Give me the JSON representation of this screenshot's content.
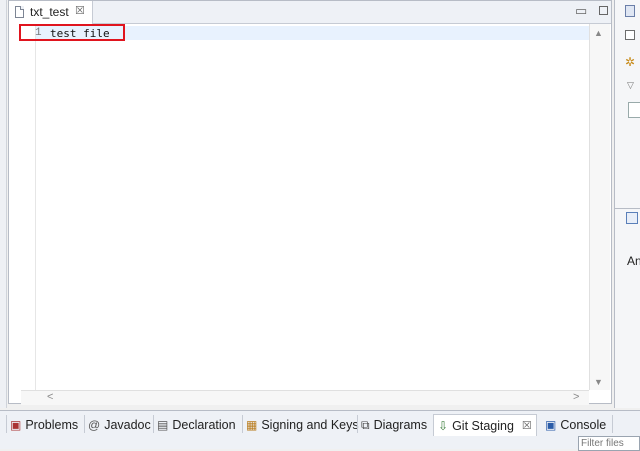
{
  "editor": {
    "tab_title": "txt_test",
    "close_glyph": "☒",
    "minimize_glyph": "▭",
    "lines": [
      {
        "number": "1",
        "text": "test_file"
      }
    ],
    "scroll": {
      "up": "▲",
      "down": "▼",
      "left": "<",
      "right": ">"
    }
  },
  "right_panel": {
    "partial_label": "An"
  },
  "bottom_tabs": [
    {
      "label": "Problems",
      "icon": "problems-icon"
    },
    {
      "label": "Javadoc",
      "icon": "at-icon"
    },
    {
      "label": "Declaration",
      "icon": "declaration-icon"
    },
    {
      "label": "Signing and Keys",
      "icon": "keys-icon"
    },
    {
      "label": "Diagrams",
      "icon": "diagram-icon"
    },
    {
      "label": "Git Staging",
      "icon": "git-staging-icon",
      "active": true,
      "close_glyph": "☒"
    },
    {
      "label": "Console",
      "icon": "console-icon"
    }
  ],
  "filter": {
    "placeholder": "Filter files"
  },
  "colors": {
    "highlight": "#e0141e",
    "current_line": "#e8f2fe"
  }
}
